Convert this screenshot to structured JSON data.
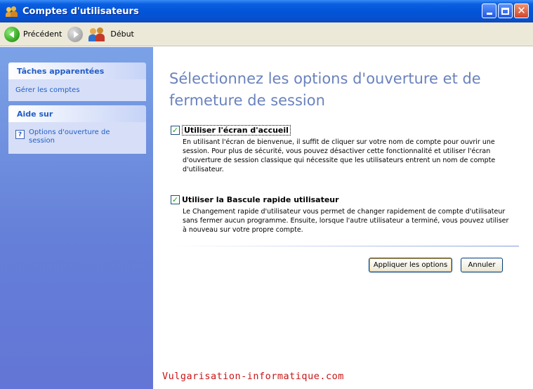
{
  "window": {
    "title": "Comptes d'utilisateurs"
  },
  "toolbar": {
    "back_label": "Précédent",
    "home_label": "Début"
  },
  "sidebar": {
    "related_tasks": {
      "header": "Tâches apparentées",
      "items": [
        "Gérer les comptes"
      ]
    },
    "help": {
      "header": "Aide sur",
      "items": [
        "Options d'ouverture de session"
      ]
    }
  },
  "main": {
    "heading": "Sélectionnez les options d'ouverture et de fermeture de session",
    "options": [
      {
        "label": "Utiliser l'écran d'accueil",
        "checked": true,
        "description": "En utilisant l'écran de bienvenue, il suffit de cliquer sur votre nom de compte pour ouvrir une session. Pour plus de sécurité, vous pouvez désactiver cette fonctionnalité et utiliser l'écran d'ouverture de session classique qui nécessite que les utilisateurs entrent un nom de compte d'utilisateur."
      },
      {
        "label": "Utiliser la Bascule rapide utilisateur",
        "checked": true,
        "description": "Le Changement rapide d'utilisateur vous permet de changer rapidement de compte d'utilisateur sans fermer aucun programme. Ensuite, lorsque l'autre utilisateur a terminé, vous pouvez utiliser à nouveau sur votre propre compte."
      }
    ],
    "apply_button": "Appliquer les options",
    "cancel_button": "Annuler"
  },
  "watermark": "Vulgarisation-informatique.com",
  "colors": {
    "titlebar": "#0355d8",
    "sidebar": "#6a85da",
    "heading": "#6a82bd",
    "link": "#215dc6",
    "watermark": "#c81414",
    "checkmark": "#21a121"
  },
  "icons": {
    "title": "users-icon",
    "back": "back-arrow-icon",
    "forward": "forward-arrow-icon",
    "home": "home-users-icon",
    "help": "help-icon"
  }
}
